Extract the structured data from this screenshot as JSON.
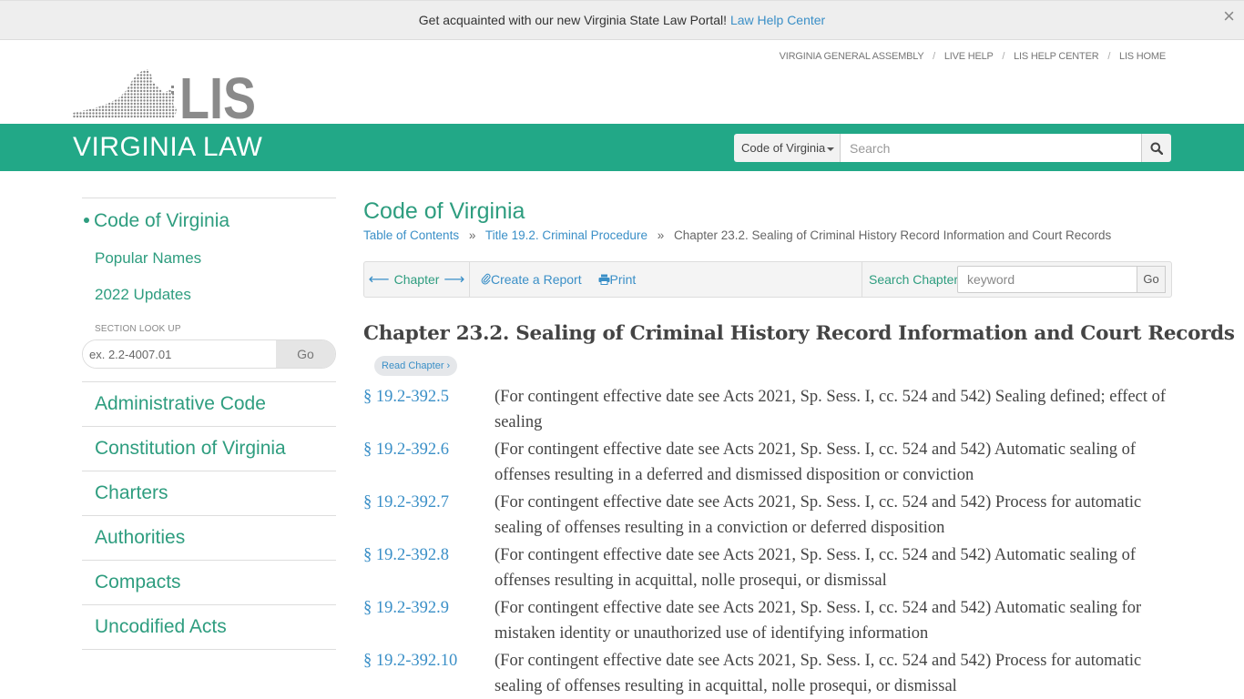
{
  "banner": {
    "text": "Get acquainted with our new Virginia State Law Portal!",
    "link_label": "Law Help Center",
    "close_glyph": "×"
  },
  "topnav": {
    "items": [
      "VIRGINIA GENERAL ASSEMBLY",
      "LIVE HELP",
      "LIS HELP CENTER",
      "LIS HOME"
    ],
    "separator": "/"
  },
  "logo": {
    "text": "LIS"
  },
  "header": {
    "site_title": "VIRGINIA LAW",
    "search": {
      "scope_selected": "Code of Virginia",
      "placeholder": "Search",
      "value": ""
    }
  },
  "sidebar": {
    "active_item": "Code of Virginia",
    "sub_items": [
      "Popular Names",
      "2022 Updates"
    ],
    "lookup": {
      "label": "SECTION LOOK UP",
      "placeholder": "ex. 2.2-4007.01",
      "go_label": "Go"
    },
    "main_items": [
      "Administrative Code",
      "Constitution of Virginia",
      "Charters",
      "Authorities",
      "Compacts",
      "Uncodified Acts"
    ]
  },
  "main": {
    "title": "Code of Virginia",
    "breadcrumb": {
      "items": [
        "Table of Contents",
        "Title 19.2. Criminal Procedure"
      ],
      "current": "Chapter 23.2. Sealing of Criminal History Record Information and Court Records",
      "separator": "»"
    },
    "toolbar": {
      "chapter_label": "Chapter",
      "prev_arrow": "⟵",
      "next_arrow": "⟶",
      "create_report_label": "Create a Report",
      "print_label": "Print",
      "search_chapter_label": "Search Chapter",
      "keyword_placeholder": "keyword",
      "go_label": "Go"
    },
    "chapter_heading": "Chapter 23.2. Sealing of Criminal History Record Information and Court Records",
    "read_chapter_label": "Read Chapter ›",
    "sections": [
      {
        "number": "§ 19.2-392.5",
        "description": "(For contingent effective date see Acts 2021, Sp. Sess. I, cc. 524 and 542) Sealing defined; effect of sealing"
      },
      {
        "number": "§ 19.2-392.6",
        "description": "(For contingent effective date see Acts 2021, Sp. Sess. I, cc. 524 and 542) Automatic sealing of offenses resulting in a deferred and dismissed disposition or conviction"
      },
      {
        "number": "§ 19.2-392.7",
        "description": "(For contingent effective date see Acts 2021, Sp. Sess. I, cc. 524 and 542) Process for automatic sealing of offenses resulting in a conviction or deferred disposition"
      },
      {
        "number": "§ 19.2-392.8",
        "description": "(For contingent effective date see Acts 2021, Sp. Sess. I, cc. 524 and 542) Automatic sealing of offenses resulting in acquittal, nolle prosequi, or dismissal"
      },
      {
        "number": "§ 19.2-392.9",
        "description": "(For contingent effective date see Acts 2021, Sp. Sess. I, cc. 524 and 542) Automatic sealing for mistaken identity or unauthorized use of identifying information"
      },
      {
        "number": "§ 19.2-392.10",
        "description": "(For contingent effective date see Acts 2021, Sp. Sess. I, cc. 524 and 542) Process for automatic sealing of offenses resulting in acquittal, nolle prosequi, or dismissal"
      }
    ]
  },
  "colors": {
    "brand_green": "#22a887",
    "link_green": "#2e9d7f",
    "link_blue": "#3a8fc7",
    "logo_gray": "#8a8a8a"
  }
}
